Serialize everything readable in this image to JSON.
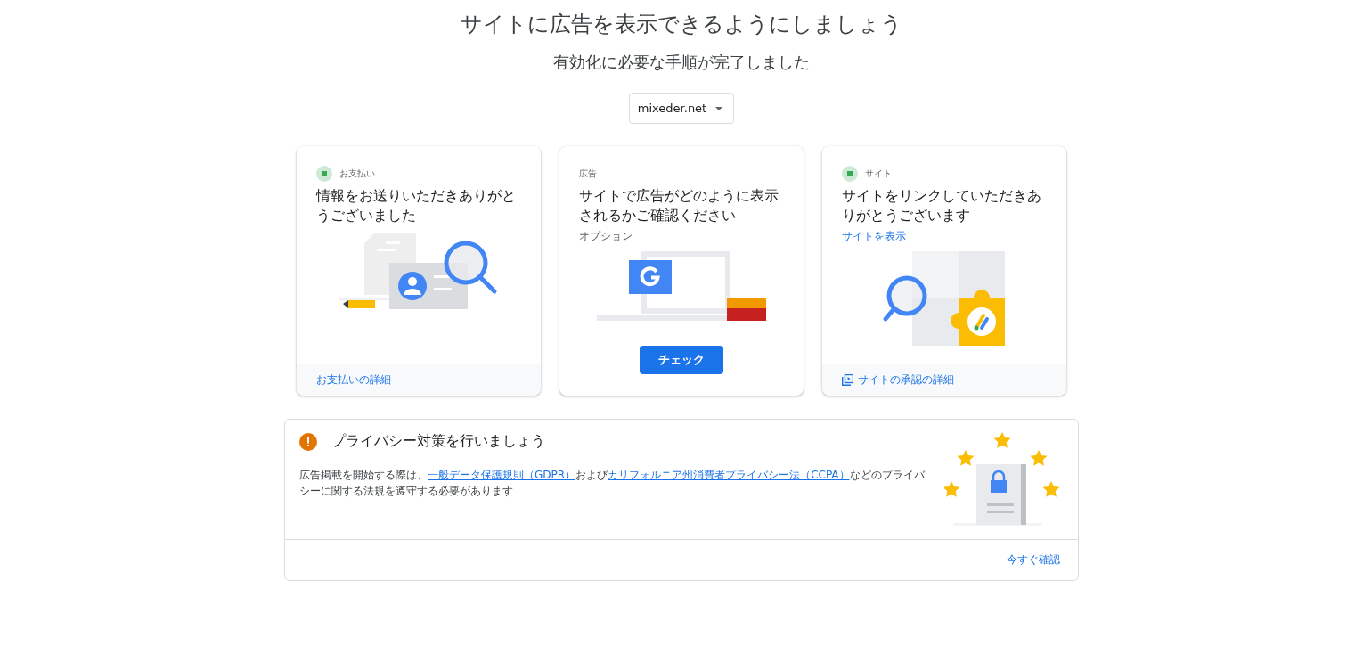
{
  "header": {
    "title": "サイトに広告を表示できるようにしましょう",
    "subtitle": "有効化に必要な手順が完了しました"
  },
  "site_selector": {
    "value": "mixeder.net"
  },
  "cards": [
    {
      "kind": "payment",
      "label": "お支払い",
      "completed": true,
      "title": "情報をお送りいただきありがとうございました",
      "footer_link": "お支払いの詳細"
    },
    {
      "kind": "ads",
      "label": "広告",
      "completed": false,
      "title": "サイトで広告がどのように表示されるかご確認ください",
      "note": "オプション",
      "button": "チェック"
    },
    {
      "kind": "site",
      "label": "サイト",
      "completed": true,
      "title": "サイトをリンクしていただきありがとうございます",
      "link": "サイトを表示",
      "footer_link": "サイトの承認の詳細"
    }
  ],
  "privacy": {
    "title": "プライバシー対策を行いましょう",
    "body": [
      {
        "kind": "text",
        "text": "広告掲載を開始する際は、"
      },
      {
        "kind": "link",
        "text": "一般データ保護規則（GDPR）"
      },
      {
        "kind": "text",
        "text": "および"
      },
      {
        "kind": "link",
        "text": "カリフォルニア州消費者プライバシー法（CCPA）"
      },
      {
        "kind": "text",
        "text": "などのプライバシーに関する法規を遵守する必要があります"
      }
    ],
    "action": "今すぐ確認"
  }
}
